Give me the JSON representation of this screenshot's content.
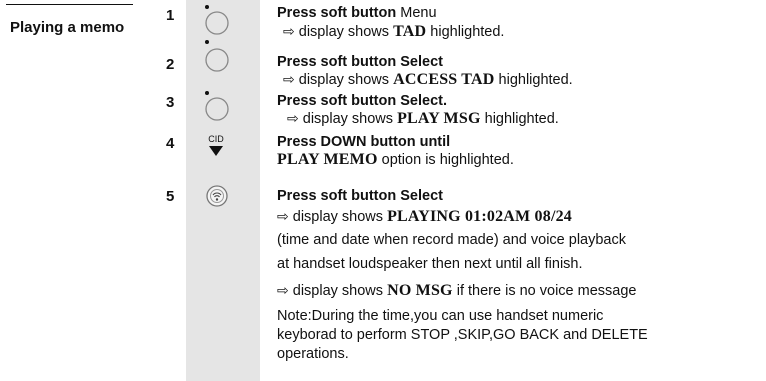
{
  "section": {
    "title": "Playing a memo"
  },
  "glyphs": {
    "arrow": "⇨"
  },
  "steps": [
    {
      "number": "1",
      "icon": "soft-button-icon",
      "action": "Press soft button",
      "action_tail": " Menu",
      "result_pre": " display shows ",
      "result_code": "TAD",
      "result_post": " highlighted."
    },
    {
      "number": "2",
      "icon": "soft-button-icon",
      "action": "Press soft button Select",
      "result_pre": " display shows ",
      "result_code": "ACCESS TAD",
      "result_post": " highlighted."
    },
    {
      "number": "3",
      "icon": "soft-button-icon",
      "action": "Press soft button Select.",
      "result_pre": " display shows ",
      "result_code": "PLAY MSG",
      "result_post": "  highlighted."
    },
    {
      "number": "4",
      "icon": "cid-down-button-icon",
      "icon_label": "CID",
      "action": "Press DOWN button until",
      "option_code": "PLAY MEMO",
      "option_post": " option is highlighted."
    },
    {
      "number": "5",
      "icon": "talk-button-icon",
      "action": "Press soft button Select",
      "result_pre": " display shows  ",
      "result_code": "PLAYING 01:02AM 08/24",
      "note_1": "(time and date when record made) and voice playback",
      "note_2": "at handset loudspeaker then next until all finish.",
      "result2_pre": " display shows  ",
      "result2_code": "NO MSG",
      "result2_post": "  if there is no voice message",
      "note_lines": [
        "Note:During the time,you can use handset numeric",
        "keyborad to perform STOP ,SKIP,GO BACK and DELETE",
        "operations."
      ]
    }
  ]
}
